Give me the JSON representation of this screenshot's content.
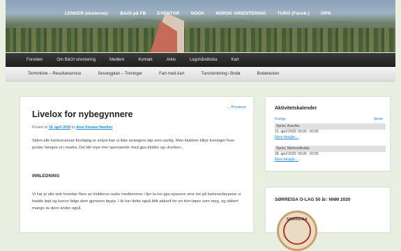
{
  "header": {
    "top_links": [
      "LENKER (eksterne):",
      "B&OI på FB",
      "EVENTOR",
      "NOOK",
      "NORSK ORIENTERING",
      "TURO (Faceb.)",
      "OPN"
    ]
  },
  "nav_primary": [
    "Forsiden",
    "Om B&OI orientering",
    "Medlem",
    "Kontakt",
    "Arkiv",
    "Lagshåndboka",
    "Kart"
  ],
  "nav_secondary": [
    "Terminliste – Resultatservice",
    "Sesongplan – Treninger",
    "Fart-med-kart",
    "Turorientering i Bodø",
    "Bodøskolen"
  ],
  "article": {
    "prev_link": "← Previous",
    "title": "Livelox for nybegynnere",
    "posted_prefix": "Posted on",
    "date": "15. april 2020",
    "by": "by",
    "author": "Arne Kristian Nordhei",
    "intro": "Siden alle konkurranser foreløpig er avlyst kan vi ikke arrangere løp som vanlig. Men klubben tilbyr treninger hvor poster henges ut i marka. Det blir mye mer spennende med gps-klokke og «livelox».",
    "heading": "INNLEDNING",
    "body": "Vi har jo alle sett hvordan flere av klubbens raske medlemmer i fjor la inn gps-sporene sine inn på kartene/løypene vi hadde løpt og kunne følge dem gjennom løypa. I år har dette også blitt aktuelt for en trim-løper som meg, og sikkert mange av dere andre også."
  },
  "sidebar": {
    "calendar": {
      "title": "Aktivitetskalender",
      "prev": "Forrige",
      "next": "Neste",
      "events": [
        {
          "name": "Sprint, Ausvika",
          "date": "21. april 2020: 00:00 - 00:00",
          "more": "Flere detaljer…"
        },
        {
          "name": "Sprint, Mørkvedbukta",
          "date": "28. april 2020: 00:00 - 00:00",
          "more": "Flere detaljer…"
        }
      ]
    },
    "anniversary": {
      "title": "SØRREISA O-LAG 50 år: NNM 2020",
      "logo_text": "SØRREISA"
    }
  },
  "colors": {
    "link": "#1b8be0",
    "nav_dark": "#2a2a2a",
    "background": "#e9f0e1"
  }
}
